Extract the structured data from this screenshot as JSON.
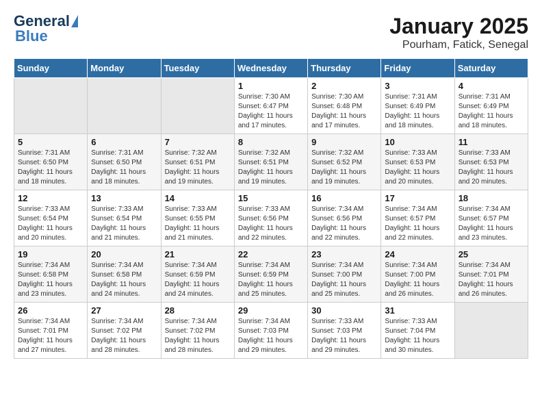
{
  "header": {
    "logo_line1": "General",
    "logo_line2": "Blue",
    "title": "January 2025",
    "subtitle": "Pourham, Fatick, Senegal"
  },
  "calendar": {
    "days_of_week": [
      "Sunday",
      "Monday",
      "Tuesday",
      "Wednesday",
      "Thursday",
      "Friday",
      "Saturday"
    ],
    "weeks": [
      [
        {
          "day": "",
          "empty": true
        },
        {
          "day": "",
          "empty": true
        },
        {
          "day": "",
          "empty": true
        },
        {
          "day": "1",
          "sunrise": "7:30 AM",
          "sunset": "6:47 PM",
          "daylight": "11 hours and 17 minutes."
        },
        {
          "day": "2",
          "sunrise": "7:30 AM",
          "sunset": "6:48 PM",
          "daylight": "11 hours and 17 minutes."
        },
        {
          "day": "3",
          "sunrise": "7:31 AM",
          "sunset": "6:49 PM",
          "daylight": "11 hours and 18 minutes."
        },
        {
          "day": "4",
          "sunrise": "7:31 AM",
          "sunset": "6:49 PM",
          "daylight": "11 hours and 18 minutes."
        }
      ],
      [
        {
          "day": "5",
          "sunrise": "7:31 AM",
          "sunset": "6:50 PM",
          "daylight": "11 hours and 18 minutes."
        },
        {
          "day": "6",
          "sunrise": "7:31 AM",
          "sunset": "6:50 PM",
          "daylight": "11 hours and 18 minutes."
        },
        {
          "day": "7",
          "sunrise": "7:32 AM",
          "sunset": "6:51 PM",
          "daylight": "11 hours and 19 minutes."
        },
        {
          "day": "8",
          "sunrise": "7:32 AM",
          "sunset": "6:51 PM",
          "daylight": "11 hours and 19 minutes."
        },
        {
          "day": "9",
          "sunrise": "7:32 AM",
          "sunset": "6:52 PM",
          "daylight": "11 hours and 19 minutes."
        },
        {
          "day": "10",
          "sunrise": "7:33 AM",
          "sunset": "6:53 PM",
          "daylight": "11 hours and 20 minutes."
        },
        {
          "day": "11",
          "sunrise": "7:33 AM",
          "sunset": "6:53 PM",
          "daylight": "11 hours and 20 minutes."
        }
      ],
      [
        {
          "day": "12",
          "sunrise": "7:33 AM",
          "sunset": "6:54 PM",
          "daylight": "11 hours and 20 minutes."
        },
        {
          "day": "13",
          "sunrise": "7:33 AM",
          "sunset": "6:54 PM",
          "daylight": "11 hours and 21 minutes."
        },
        {
          "day": "14",
          "sunrise": "7:33 AM",
          "sunset": "6:55 PM",
          "daylight": "11 hours and 21 minutes."
        },
        {
          "day": "15",
          "sunrise": "7:33 AM",
          "sunset": "6:56 PM",
          "daylight": "11 hours and 22 minutes."
        },
        {
          "day": "16",
          "sunrise": "7:34 AM",
          "sunset": "6:56 PM",
          "daylight": "11 hours and 22 minutes."
        },
        {
          "day": "17",
          "sunrise": "7:34 AM",
          "sunset": "6:57 PM",
          "daylight": "11 hours and 22 minutes."
        },
        {
          "day": "18",
          "sunrise": "7:34 AM",
          "sunset": "6:57 PM",
          "daylight": "11 hours and 23 minutes."
        }
      ],
      [
        {
          "day": "19",
          "sunrise": "7:34 AM",
          "sunset": "6:58 PM",
          "daylight": "11 hours and 23 minutes."
        },
        {
          "day": "20",
          "sunrise": "7:34 AM",
          "sunset": "6:58 PM",
          "daylight": "11 hours and 24 minutes."
        },
        {
          "day": "21",
          "sunrise": "7:34 AM",
          "sunset": "6:59 PM",
          "daylight": "11 hours and 24 minutes."
        },
        {
          "day": "22",
          "sunrise": "7:34 AM",
          "sunset": "6:59 PM",
          "daylight": "11 hours and 25 minutes."
        },
        {
          "day": "23",
          "sunrise": "7:34 AM",
          "sunset": "7:00 PM",
          "daylight": "11 hours and 25 minutes."
        },
        {
          "day": "24",
          "sunrise": "7:34 AM",
          "sunset": "7:00 PM",
          "daylight": "11 hours and 26 minutes."
        },
        {
          "day": "25",
          "sunrise": "7:34 AM",
          "sunset": "7:01 PM",
          "daylight": "11 hours and 26 minutes."
        }
      ],
      [
        {
          "day": "26",
          "sunrise": "7:34 AM",
          "sunset": "7:01 PM",
          "daylight": "11 hours and 27 minutes."
        },
        {
          "day": "27",
          "sunrise": "7:34 AM",
          "sunset": "7:02 PM",
          "daylight": "11 hours and 28 minutes."
        },
        {
          "day": "28",
          "sunrise": "7:34 AM",
          "sunset": "7:02 PM",
          "daylight": "11 hours and 28 minutes."
        },
        {
          "day": "29",
          "sunrise": "7:34 AM",
          "sunset": "7:03 PM",
          "daylight": "11 hours and 29 minutes."
        },
        {
          "day": "30",
          "sunrise": "7:33 AM",
          "sunset": "7:03 PM",
          "daylight": "11 hours and 29 minutes."
        },
        {
          "day": "31",
          "sunrise": "7:33 AM",
          "sunset": "7:04 PM",
          "daylight": "11 hours and 30 minutes."
        },
        {
          "day": "",
          "empty": true
        }
      ]
    ]
  }
}
